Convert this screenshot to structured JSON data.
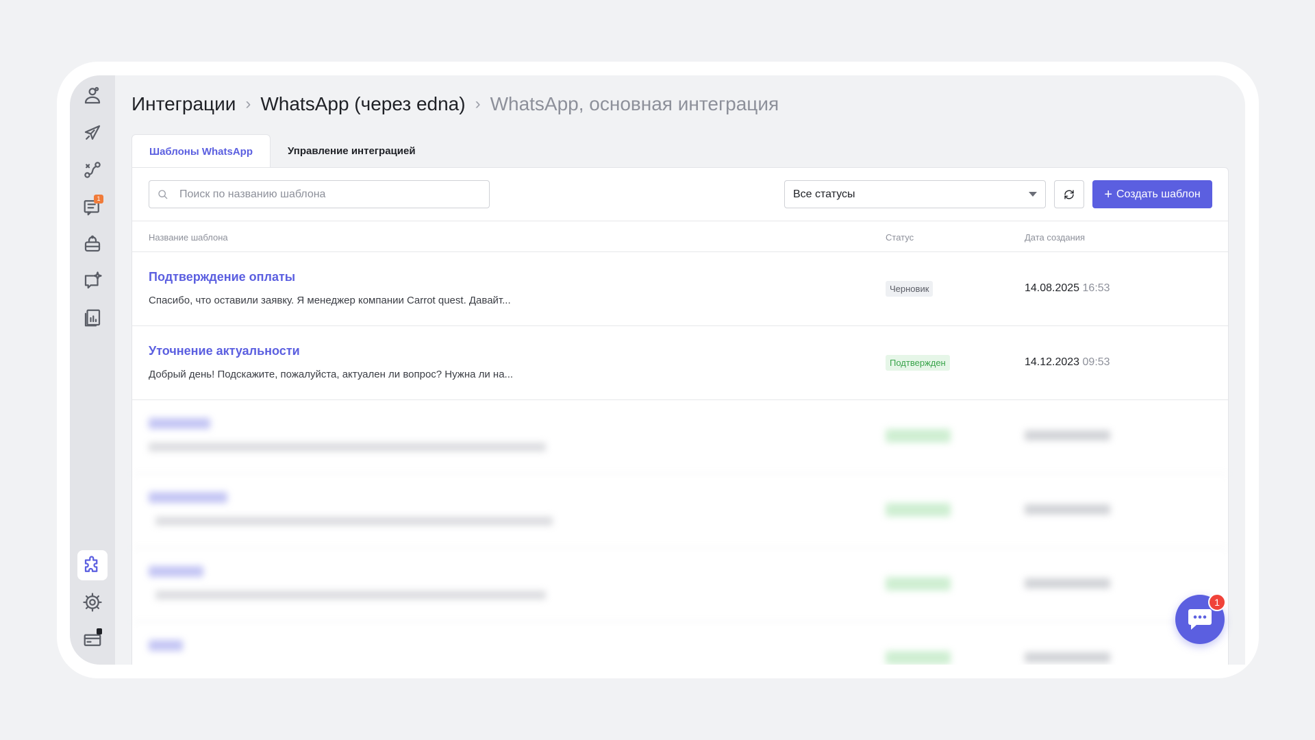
{
  "breadcrumb": {
    "items": [
      "Интеграции",
      "WhatsApp (через edna)",
      "WhatsApp, основная интеграция"
    ],
    "separator": ">"
  },
  "tabs": [
    {
      "label": "Шаблоны WhatsApp",
      "active": true
    },
    {
      "label": "Управление интеграцией",
      "active": false
    }
  ],
  "toolbar": {
    "search_placeholder": "Поиск по названию шаблона",
    "status_filter": "Все статусы",
    "create_label": "Создать шаблон",
    "create_icon": "+"
  },
  "table": {
    "columns": [
      "Название шаблона",
      "Статус",
      "Дата создания"
    ],
    "rows": [
      {
        "name": "Подтверждение оплаты",
        "desc": "Спасибо, что оставили заявку. Я менеджер компании Carrot quest. Давайт...",
        "status": "Черновик",
        "status_kind": "draft",
        "date": "14.08.2025",
        "time": "16:53"
      },
      {
        "name": "Уточнение актуальности",
        "desc": "Добрый день! Подскажите, пожалуйста, актуален ли вопрос? Нужна ли на...",
        "status": "Подтвержден",
        "status_kind": "ok",
        "date": "14.12.2023",
        "time": "09:53"
      },
      {
        "name": "",
        "desc": "",
        "status": "",
        "status_kind": "ok",
        "date": "",
        "time": "",
        "blurred": true
      },
      {
        "name": "",
        "desc": "",
        "status": "",
        "status_kind": "ok",
        "date": "",
        "time": "",
        "blurred": true
      },
      {
        "name": "",
        "desc": "",
        "status": "",
        "status_kind": "ok",
        "date": "",
        "time": "",
        "blurred": true
      },
      {
        "name": "",
        "desc": "",
        "status": "",
        "status_kind": "ok",
        "date": "",
        "time": "",
        "blurred": true
      }
    ]
  },
  "sidebar": {
    "icons": [
      "users-icon",
      "rocket-icon",
      "route-icon",
      "chat-list-icon",
      "bot-icon",
      "sparkle-chat-icon",
      "reports-icon",
      "puzzle-icon",
      "gear-icon",
      "billing-icon"
    ],
    "chat_badge": "1"
  },
  "chat_widget": {
    "badge": "1"
  },
  "colors": {
    "accent": "#5b5fe0",
    "success": "#38a44a",
    "badge": "#f0433a"
  }
}
